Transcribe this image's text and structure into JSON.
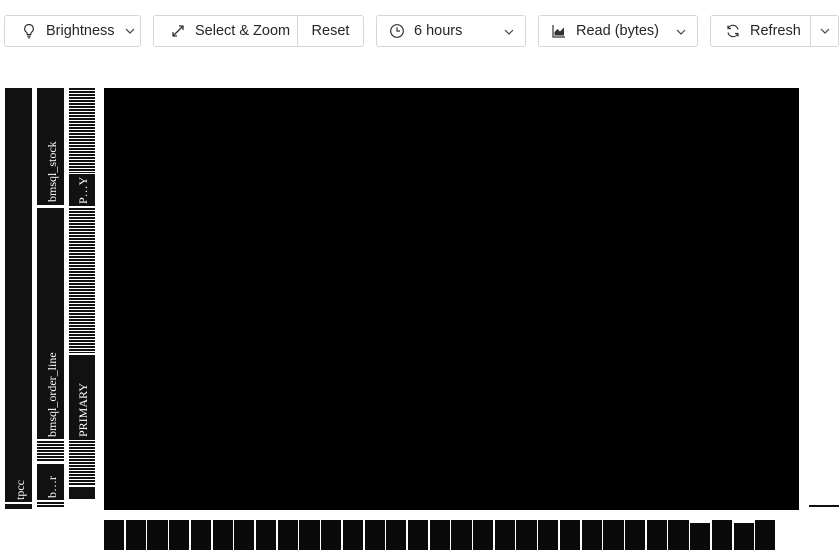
{
  "toolbar": {
    "brightness_label": "Brightness",
    "select_zoom_label": "Select & Zoom",
    "reset_label": "Reset",
    "time_range_label": "6 hours",
    "metric_label": "Read (bytes)",
    "refresh_label": "Refresh"
  },
  "heatmap": {
    "database_label": "tpcc",
    "tables": [
      "bmsql_stock",
      "bmsql_order_line",
      "b…r"
    ],
    "indexes": [
      "P…Y",
      "PRIMARY"
    ]
  },
  "icons": {
    "brightness": "lightbulb-icon",
    "select_zoom": "diagonal-arrows-icon",
    "time": "clock-icon",
    "metric": "area-chart-icon",
    "refresh": "refresh-icon",
    "dropdown": "chevron-down-icon"
  }
}
